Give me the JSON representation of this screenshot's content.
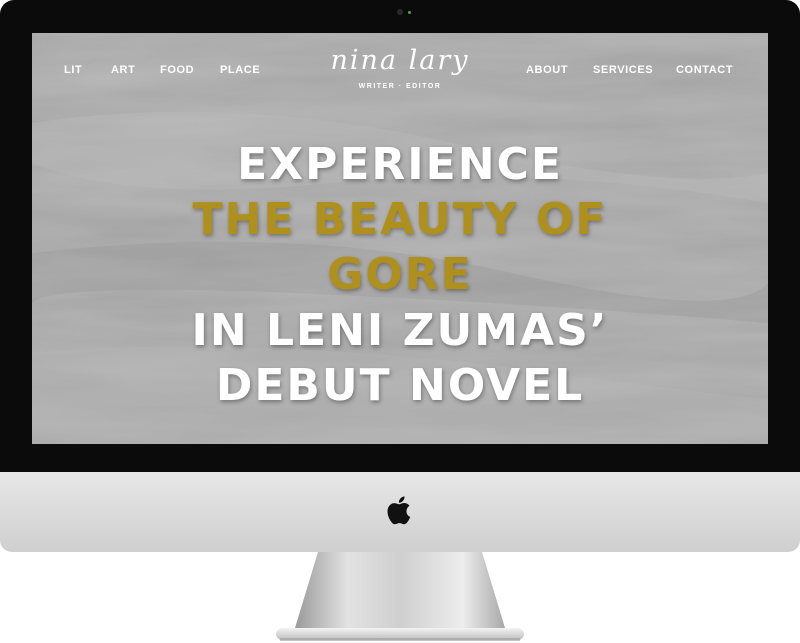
{
  "nav": {
    "left_items": [
      "LIT",
      "ART",
      "FOOD",
      "PLACE"
    ],
    "right_items": [
      "ABOUT",
      "SERVICES",
      "CONTACT"
    ]
  },
  "logo": {
    "name": "nina lary",
    "tagline": "WRITER · EDITOR"
  },
  "hero": {
    "lines": [
      "EXPERIENCE",
      "THE BEAUTY OF",
      "GORE",
      "IN LENI ZUMAS’",
      "DEBUT NOVEL"
    ]
  },
  "colors": {
    "accent_gold": "#b0901c",
    "text_white": "#ffffff",
    "bezel": "#0b0b0b",
    "screen_bg": "#a3a3a3"
  },
  "icons": {
    "chin_logo": "apple-logo",
    "camera": "camera-dot"
  }
}
